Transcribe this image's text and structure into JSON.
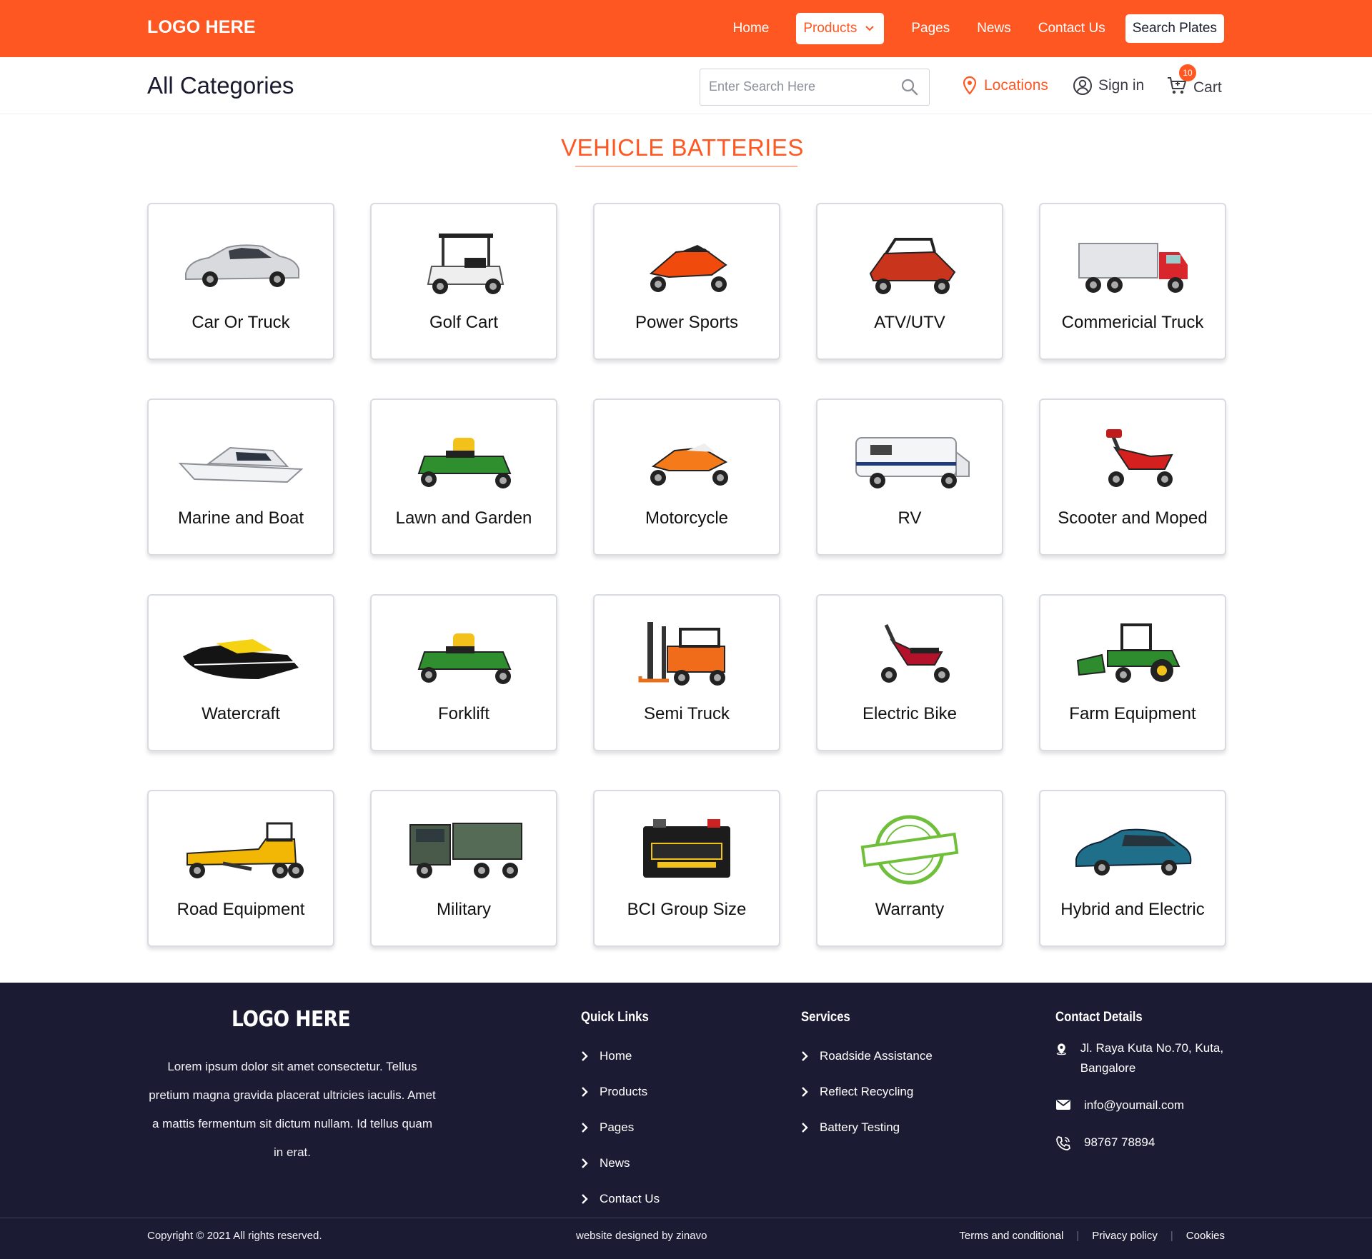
{
  "header": {
    "logo": "LOGO HERE",
    "nav": [
      {
        "label": "Home"
      },
      {
        "label": "Products"
      },
      {
        "label": "Pages"
      },
      {
        "label": "News"
      },
      {
        "label": "Contact Us"
      }
    ],
    "search_plates": "Search Plates"
  },
  "subbar": {
    "title": "All Categories",
    "search_placeholder": "Enter Search Here",
    "locations": "Locations",
    "sign_in": "Sign in",
    "cart": "Cart",
    "cart_count": "10"
  },
  "section": {
    "title": "VEHICLE BATTERIES"
  },
  "categories": [
    {
      "label": "Car Or Truck",
      "icon": "car-icon"
    },
    {
      "label": "Golf Cart",
      "icon": "golf-cart-icon"
    },
    {
      "label": "Power Sports",
      "icon": "sport-bike-icon"
    },
    {
      "label": "ATV/UTV",
      "icon": "utv-icon"
    },
    {
      "label": "Commericial Truck",
      "icon": "box-truck-icon"
    },
    {
      "label": "Marine and Boat",
      "icon": "yacht-icon"
    },
    {
      "label": "Lawn and Garden",
      "icon": "mower-icon"
    },
    {
      "label": "Motorcycle",
      "icon": "motorcycle-icon"
    },
    {
      "label": "RV",
      "icon": "rv-icon"
    },
    {
      "label": "Scooter and Moped",
      "icon": "scooter-icon"
    },
    {
      "label": "Watercraft",
      "icon": "jetski-icon"
    },
    {
      "label": "Forklift",
      "icon": "mower-icon"
    },
    {
      "label": "Semi Truck",
      "icon": "forklift-icon"
    },
    {
      "label": "Electric Bike",
      "icon": "e-bike-icon"
    },
    {
      "label": "Farm Equipment",
      "icon": "tractor-icon"
    },
    {
      "label": "Road Equipment",
      "icon": "grader-icon"
    },
    {
      "label": "Military",
      "icon": "military-truck-icon"
    },
    {
      "label": "BCI Group Size",
      "icon": "battery-icon"
    },
    {
      "label": "Warranty",
      "icon": "warranty-stamp-icon"
    },
    {
      "label": "Hybrid and Electric",
      "icon": "hybrid-car-icon"
    }
  ],
  "footer": {
    "logo": "LOGO HERE",
    "about": "Lorem ipsum dolor sit amet consectetur. Tellus pretium magna gravida placerat ultricies iaculis. Amet a mattis fermentum sit dictum nullam. Id tellus quam in erat.",
    "quick_links_title": "Quick Links",
    "quick_links": [
      "Home",
      "Products",
      "Pages",
      "News",
      "Contact Us"
    ],
    "services_title": "Services",
    "services": [
      "Roadside Assistance",
      "Reflect Recycling",
      "Battery Testing"
    ],
    "contact_title": "Contact Details",
    "address": "Jl. Raya Kuta No.70, Kuta, Bangalore",
    "email": "info@youmail.com",
    "phone": "98767 78894",
    "copyright": "Copyright © 2021 All rights reserved.",
    "designed_by": "website designed by zinavo",
    "legal": [
      "Terms and conditional",
      "Privacy policy",
      "Cookies"
    ]
  },
  "colors": {
    "brand": "#ff5722",
    "footer_bg": "#1b1b33"
  }
}
